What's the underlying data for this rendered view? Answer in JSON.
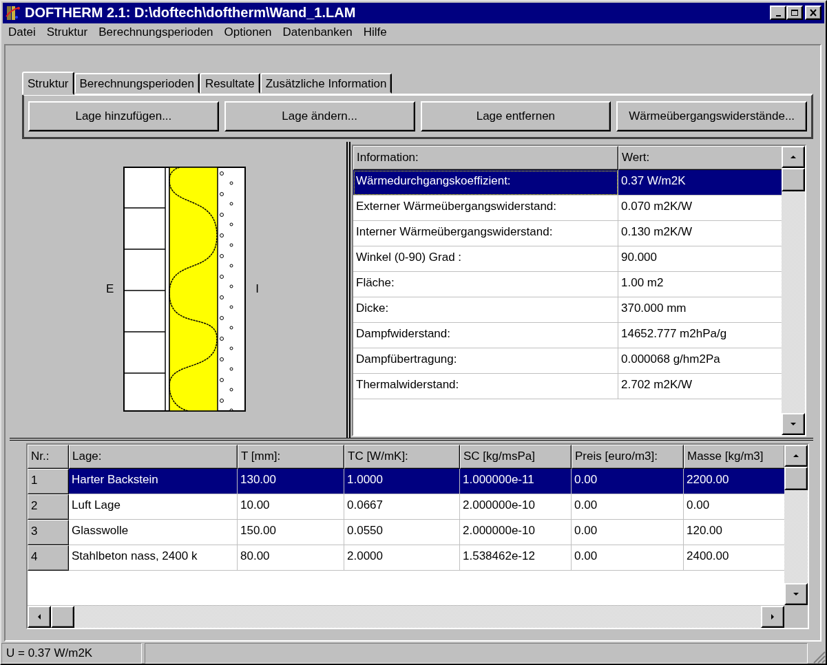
{
  "window": {
    "title": "DOFTHERM 2.1: D:\\doftech\\doftherm\\Wand_1.LAM"
  },
  "menu": [
    {
      "label": "Datei"
    },
    {
      "label": "Struktur"
    },
    {
      "label": "Berechnungsperioden"
    },
    {
      "label": "Optionen"
    },
    {
      "label": "Datenbanken"
    },
    {
      "label": "Hilfe"
    }
  ],
  "tabs": [
    {
      "label": "Struktur",
      "selected": true
    },
    {
      "label": "Berechnungsperioden",
      "selected": false
    },
    {
      "label": "Resultate",
      "selected": false
    },
    {
      "label": "Zusätzliche Information",
      "selected": false
    }
  ],
  "toolbar": {
    "buttons": [
      "Lage hinzufügen...",
      "Lage ändern...",
      "Lage entfernen",
      "Wärmeübergangswiderstände..."
    ]
  },
  "structure_drawing": {
    "exterior_label": "E",
    "interior_label": "I"
  },
  "info_table": {
    "columns": [
      "Information:",
      "Wert:"
    ],
    "rows": [
      {
        "cells": [
          "Wärmedurchgangskoeffizient:",
          "0.37 W/m2K"
        ],
        "selected": true
      },
      {
        "cells": [
          "Externer Wärmeübergangswiderstand:",
          "0.070 m2K/W"
        ],
        "selected": false
      },
      {
        "cells": [
          "Interner Wärmeübergangswiderstand:",
          "0.130 m2K/W"
        ],
        "selected": false
      },
      {
        "cells": [
          "Winkel (0-90) Grad :",
          "90.000"
        ],
        "selected": false
      },
      {
        "cells": [
          "Fläche:",
          "1.00 m2"
        ],
        "selected": false
      },
      {
        "cells": [
          "Dicke:",
          "370.000 mm"
        ],
        "selected": false
      },
      {
        "cells": [
          "Dampfwiderstand:",
          "14652.777 m2hPa/g"
        ],
        "selected": false
      },
      {
        "cells": [
          "Dampfübertragung:",
          "0.000068 g/hm2Pa"
        ],
        "selected": false
      },
      {
        "cells": [
          "Thermalwiderstand:",
          "2.702 m2K/W"
        ],
        "selected": false
      }
    ]
  },
  "layer_table": {
    "columns": [
      "Nr.:",
      "Lage:",
      "T [mm]:",
      "TC [W/mK]:",
      "SC [kg/msPa]",
      "Preis [euro/m3]:",
      "Masse [kg/m3]"
    ],
    "rows": [
      {
        "cells": [
          "1",
          "Harter Backstein",
          "130.00",
          "1.0000",
          "1.000000e-11",
          "0.00",
          "2200.00"
        ],
        "selected": true
      },
      {
        "cells": [
          "2",
          "Luft Lage",
          "10.00",
          "0.0667",
          "2.000000e-10",
          "0.00",
          "0.00"
        ],
        "selected": false
      },
      {
        "cells": [
          "3",
          "Glasswolle",
          "150.00",
          "0.0550",
          "2.000000e-10",
          "0.00",
          "120.00"
        ],
        "selected": false
      },
      {
        "cells": [
          "4",
          "Stahlbeton nass, 2400 k",
          "80.00",
          "2.0000",
          "1.538462e-12",
          "0.00",
          "2400.00"
        ],
        "selected": false
      }
    ]
  },
  "status_bar": {
    "text": "U = 0.37 W/m2K"
  }
}
